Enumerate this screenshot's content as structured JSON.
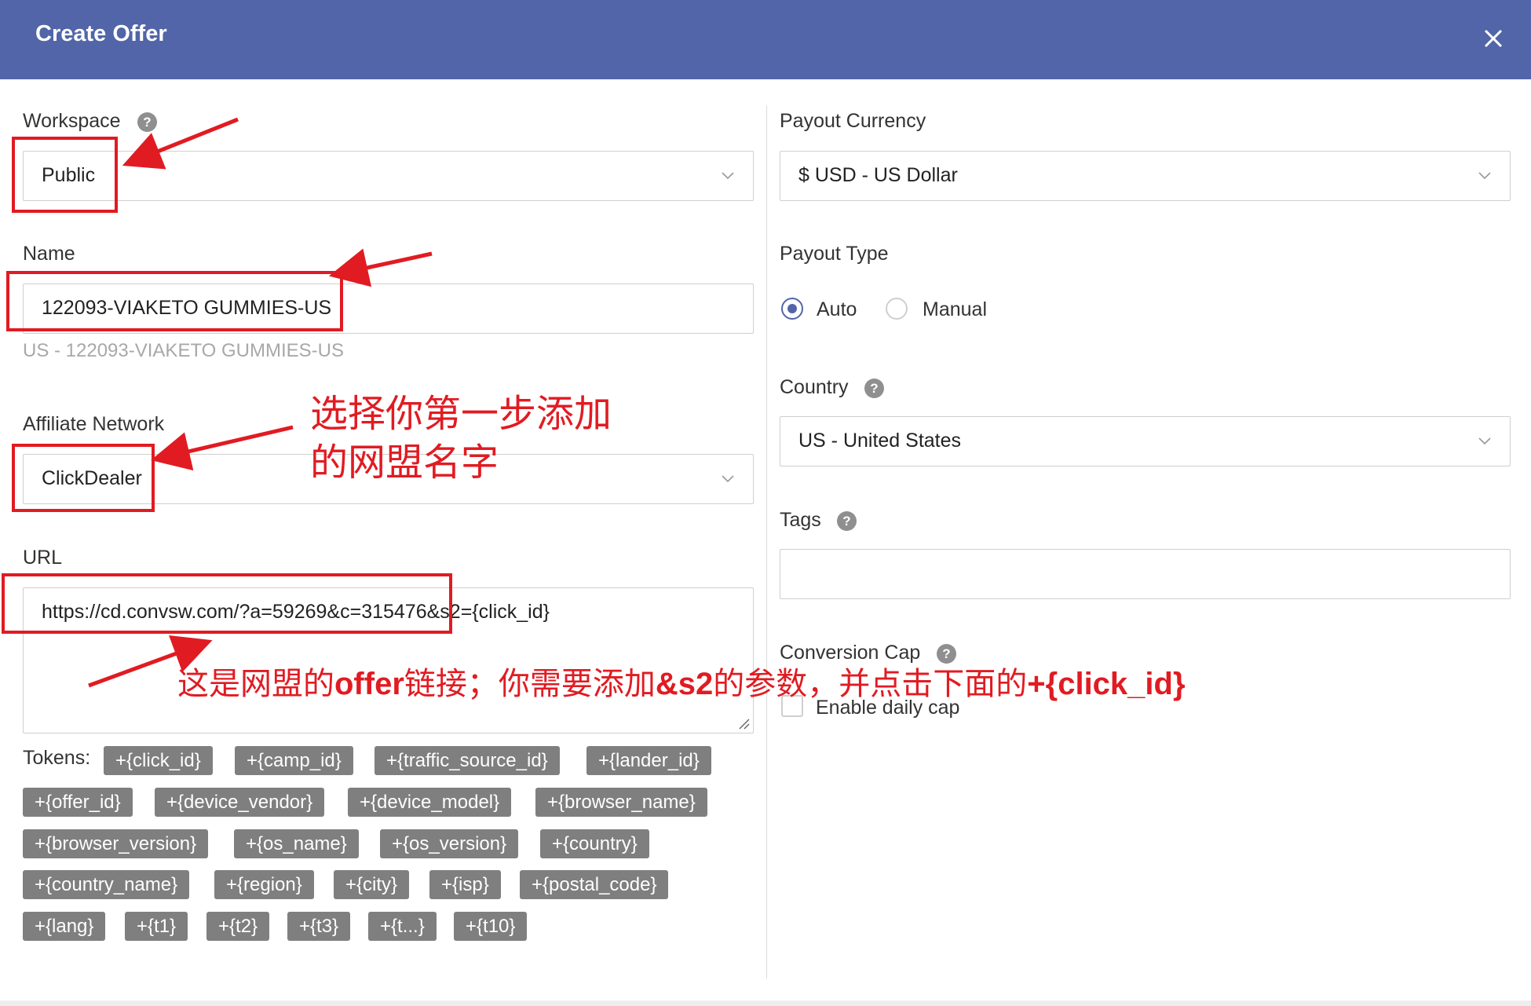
{
  "dialog": {
    "title": "Create Offer",
    "colors": {
      "header": "#5165a8",
      "annotation": "#e11b22",
      "token": "#7f7f7f"
    }
  },
  "left": {
    "workspace": {
      "label": "Workspace",
      "value": "Public"
    },
    "name": {
      "label": "Name",
      "value": "122093-VIAKETO GUMMIES-US",
      "hint": "US - 122093-VIAKETO GUMMIES-US"
    },
    "affiliate_network": {
      "label": "Affiliate Network",
      "value": "ClickDealer"
    },
    "url": {
      "label": "URL",
      "value": "https://cd.convsw.com/?a=59269&c=315476&s2={click_id}"
    },
    "tokens": {
      "label": "Tokens:",
      "items": [
        "+{click_id}",
        "+{camp_id}",
        "+{traffic_source_id}",
        "+{lander_id}",
        "+{offer_id}",
        "+{device_vendor}",
        "+{device_model}",
        "+{browser_name}",
        "+{browser_version}",
        "+{os_name}",
        "+{os_version}",
        "+{country}",
        "+{country_name}",
        "+{region}",
        "+{city}",
        "+{isp}",
        "+{postal_code}",
        "+{lang}",
        "+{t1}",
        "+{t2}",
        "+{t3}",
        "+{t...}",
        "+{t10}"
      ]
    }
  },
  "right": {
    "payout_currency": {
      "label": "Payout Currency",
      "value": "$ USD - US Dollar"
    },
    "payout_type": {
      "label": "Payout Type",
      "options": [
        "Auto",
        "Manual"
      ],
      "selected": "Auto"
    },
    "country": {
      "label": "Country",
      "value": "US - United States"
    },
    "tags": {
      "label": "Tags",
      "value": ""
    },
    "conversion_cap": {
      "label": "Conversion Cap",
      "checkbox_label": "Enable daily cap",
      "checked": false
    }
  },
  "annotations": {
    "network_note_line1": "选择你第一步添加",
    "network_note_line2": "的网盟名字",
    "url_note_part1": "这是网盟的",
    "url_note_bold1": "offer",
    "url_note_part2": "链接；你需要添加",
    "url_note_bold2": "&s2",
    "url_note_part3": "的参数，并点击下面的",
    "url_note_bold3": "+{click_id}"
  },
  "icons": [
    "close-icon",
    "help-icon",
    "chevron-down-icon",
    "resize-grip-icon",
    "arrow-annotation"
  ]
}
